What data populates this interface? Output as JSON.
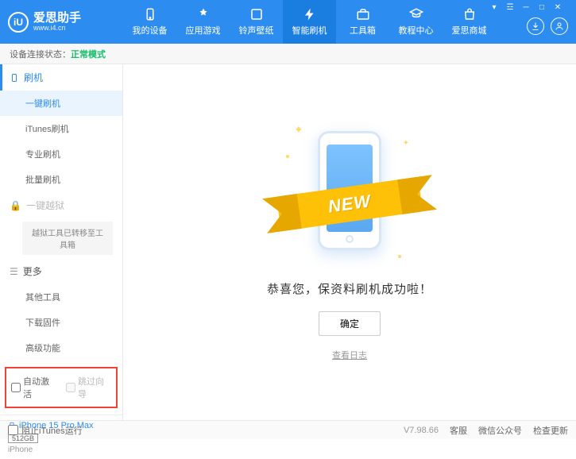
{
  "app": {
    "title": "爱思助手",
    "url": "www.i4.cn",
    "logo_letter": "iU"
  },
  "nav": [
    {
      "label": "我的设备"
    },
    {
      "label": "应用游戏"
    },
    {
      "label": "铃声壁纸"
    },
    {
      "label": "智能刷机",
      "active": true
    },
    {
      "label": "工具箱"
    },
    {
      "label": "教程中心"
    },
    {
      "label": "爱思商城"
    }
  ],
  "status": {
    "prefix": "设备连接状态：",
    "mode": "正常模式"
  },
  "sidebar": {
    "flash_group": "刷机",
    "items_flash": [
      {
        "label": "一键刷机",
        "active": true
      },
      {
        "label": "iTunes刷机"
      },
      {
        "label": "专业刷机"
      },
      {
        "label": "批量刷机"
      }
    ],
    "jailbreak_group": "一键越狱",
    "jailbreak_note": "越狱工具已转移至工具箱",
    "more_group": "更多",
    "items_more": [
      {
        "label": "其他工具"
      },
      {
        "label": "下载固件"
      },
      {
        "label": "高级功能"
      }
    ],
    "checkboxes": {
      "auto_activate": "自动激活",
      "skip_setup": "跳过向导"
    }
  },
  "device": {
    "name": "iPhone 15 Pro Max",
    "storage": "512GB",
    "type": "iPhone"
  },
  "main": {
    "ribbon": "NEW",
    "message": "恭喜您，保资料刷机成功啦！",
    "ok": "确定",
    "view_log": "查看日志"
  },
  "footer": {
    "block_itunes": "阻止iTunes运行",
    "version": "V7.98.66",
    "links": [
      "客服",
      "微信公众号",
      "检查更新"
    ]
  }
}
